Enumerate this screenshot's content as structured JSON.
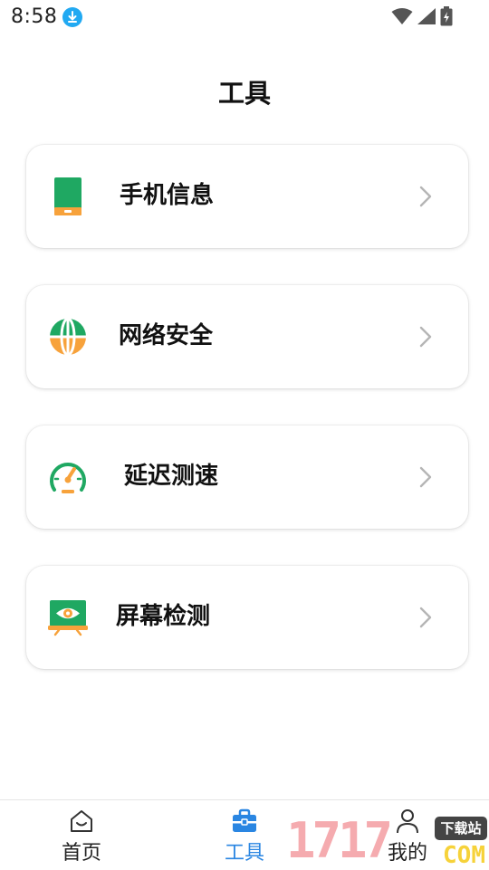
{
  "status_bar": {
    "time": "8:58"
  },
  "page": {
    "title": "工具"
  },
  "tools": [
    {
      "label": "手机信息",
      "icon": "phone-icon"
    },
    {
      "label": "网络安全",
      "icon": "globe-icon"
    },
    {
      "label": "延迟测速",
      "icon": "speedometer-icon"
    },
    {
      "label": "屏幕检测",
      "icon": "monitor-eye-icon"
    }
  ],
  "bottom_nav": {
    "items": [
      {
        "label": "首页",
        "icon": "home-icon",
        "active": false
      },
      {
        "label": "工具",
        "icon": "toolbox-icon",
        "active": true
      },
      {
        "label": "我的",
        "icon": "profile-icon",
        "active": false
      }
    ]
  },
  "watermark": {
    "digits": "1717",
    "tag": "下载站",
    "suffix": "COM"
  },
  "colors": {
    "accent": "#2a86e2",
    "green": "#1fa862",
    "orange": "#f7a23b",
    "chevron": "#b5b5b5"
  }
}
